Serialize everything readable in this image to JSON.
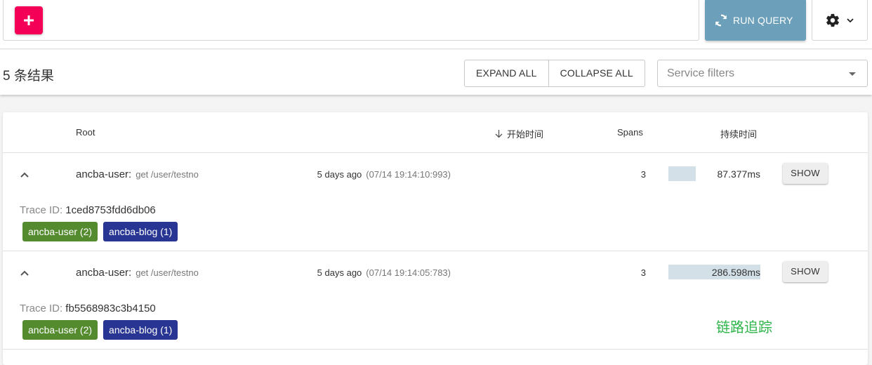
{
  "toolbar": {
    "add_icon": "plus-icon",
    "run_query_label": "RUN QUERY",
    "run_icon": "refresh-icon",
    "settings_icon": "gear-icon",
    "colors": {
      "add": "#f50057",
      "run": "#6b9fba"
    }
  },
  "results": {
    "count_label": "5 条结果",
    "expand_all": "EXPAND ALL",
    "collapse_all": "COLLAPSE ALL",
    "service_filter_placeholder": "Service filters"
  },
  "table": {
    "headers": {
      "root": "Root",
      "start_time": "开始时间",
      "spans": "Spans",
      "duration": "持续时间"
    },
    "sort_icon": "arrow-down-icon",
    "rows": [
      {
        "service": "ancba-user:",
        "operation": "get /user/testno",
        "ago": "5 days ago",
        "timestamp": "(07/14 19:14:10:993)",
        "spans": "3",
        "duration": "87.377ms",
        "duration_fraction": 0.3,
        "show_label": "SHOW",
        "trace_id_label": "Trace ID:",
        "trace_id": "1ced8753fdd6db06",
        "tags": [
          {
            "label": "ancba-user (2)",
            "color": "#558b2f"
          },
          {
            "label": "ancba-blog (1)",
            "color": "#283593"
          }
        ]
      },
      {
        "service": "ancba-user:",
        "operation": "get /user/testno",
        "ago": "5 days ago",
        "timestamp": "(07/14 19:14:05:783)",
        "spans": "3",
        "duration": "286.598ms",
        "duration_fraction": 1.0,
        "show_label": "SHOW",
        "trace_id_label": "Trace ID:",
        "trace_id": "fb5568983c3b4150",
        "tags": [
          {
            "label": "ancba-user (2)",
            "color": "#558b2f"
          },
          {
            "label": "ancba-blog (1)",
            "color": "#283593"
          }
        ]
      }
    ]
  },
  "watermark": "链路追踪"
}
